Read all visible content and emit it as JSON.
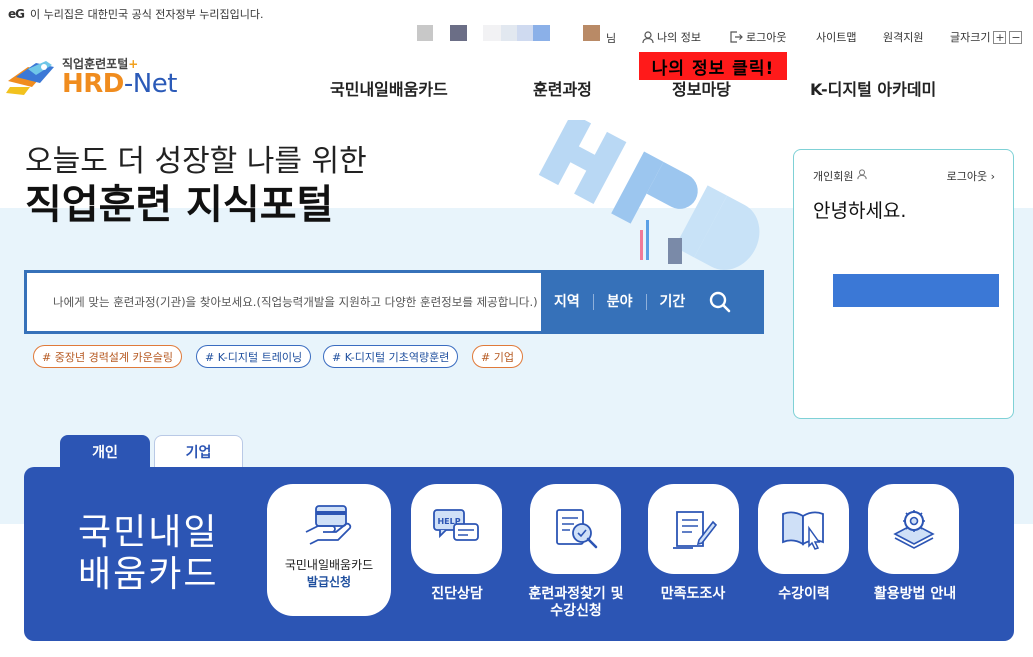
{
  "gov_banner": {
    "logo": "eG",
    "text": "이 누리집은 대한민국 공식 전자정부 누리집입니다."
  },
  "util": {
    "user_suffix": "님",
    "my_info": "나의 정보",
    "logout": "로그아웃",
    "sitemap": "사이트맵",
    "remote": "원격지원",
    "font_size": "글자크기",
    "zoom_in": "+",
    "zoom_out": "−"
  },
  "swatch_colors": [
    "#c8c8c8",
    "#6b6e86",
    "#f2f2f4",
    "#e2e8f0",
    "#cfdaf0",
    "#8bb0e8",
    "#b98a66"
  ],
  "logo": {
    "sub": "직업훈련포털",
    "plus": "+",
    "hrd": "HRD",
    "dash": "-",
    "net": "Net"
  },
  "nav": [
    "국민내일배움카드",
    "훈련과정",
    "정보마당",
    "K-디지털 아카데미"
  ],
  "annotation": "나의 정보 클릭!",
  "hero": {
    "line1": "오늘도 더 성장할 나를 위한",
    "line2": "직업훈련 지식포털"
  },
  "search": {
    "placeholder": "나에게 맞는 훈련과정(기관)을 찾아보세요.(직업능력개발을 지원하고 다양한 훈련정보를 제공합니다.)",
    "filters": [
      "지역",
      "분야",
      "기간"
    ]
  },
  "hashtags": [
    "# 중장년 경력설계 카운슬링",
    "# K-디지털 트레이닝",
    "# K-디지털 기초역량훈련",
    "# 기업"
  ],
  "login_card": {
    "member_type": "개인회원",
    "logout": "로그아웃",
    "greeting": "안녕하세요."
  },
  "tabs": [
    "개인",
    "기업"
  ],
  "panel": {
    "title": "국민내일배움카드",
    "card_issue": {
      "line1": "국민내일배움카드",
      "line2": "발급신청"
    },
    "services": [
      "진단상담",
      "훈련과정찾기 및\n수강신청",
      "만족도조사",
      "수강이력",
      "활용방법 안내"
    ]
  },
  "colors": {
    "primary": "#2c55b4",
    "search": "#3671b9",
    "accent_orange": "#f08c1e",
    "annotation": "#ff1a1a"
  }
}
